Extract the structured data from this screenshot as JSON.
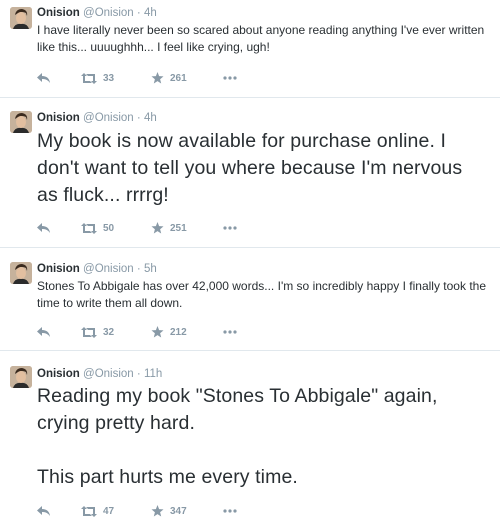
{
  "tweets": [
    {
      "name": "Onision",
      "handle": "@Onision",
      "time": "4h",
      "text": "I have literally never been so scared about anyone reading anything I've ever written like this... uuuughhh... I feel like crying, ugh!",
      "retweets": "33",
      "favorites": "261"
    },
    {
      "name": "Onision",
      "handle": "@Onision",
      "time": "4h",
      "text": "My book is now available for purchase online. I don't want to tell you where because I'm nervous as fluck... rrrrg!",
      "retweets": "50",
      "favorites": "251"
    },
    {
      "name": "Onision",
      "handle": "@Onision",
      "time": "5h",
      "text": "Stones To Abbigale has over 42,000 words... I'm so incredibly happy I finally took the time to write them all down.",
      "retweets": "32",
      "favorites": "212"
    },
    {
      "name": "Onision",
      "handle": "@Onision",
      "time": "11h",
      "text": "Reading my book \"Stones To Abbigale\" again, crying pretty hard.\n\nThis part hurts me every time.",
      "retweets": "47",
      "favorites": "347"
    }
  ],
  "separator": "·",
  "icons": {
    "reply": "reply-icon",
    "retweet": "retweet-icon",
    "favorite": "star-icon",
    "more": "more-dots-icon"
  },
  "colors": {
    "text": "#292f33",
    "muted": "#8899a6",
    "border": "#e1e8ed"
  }
}
